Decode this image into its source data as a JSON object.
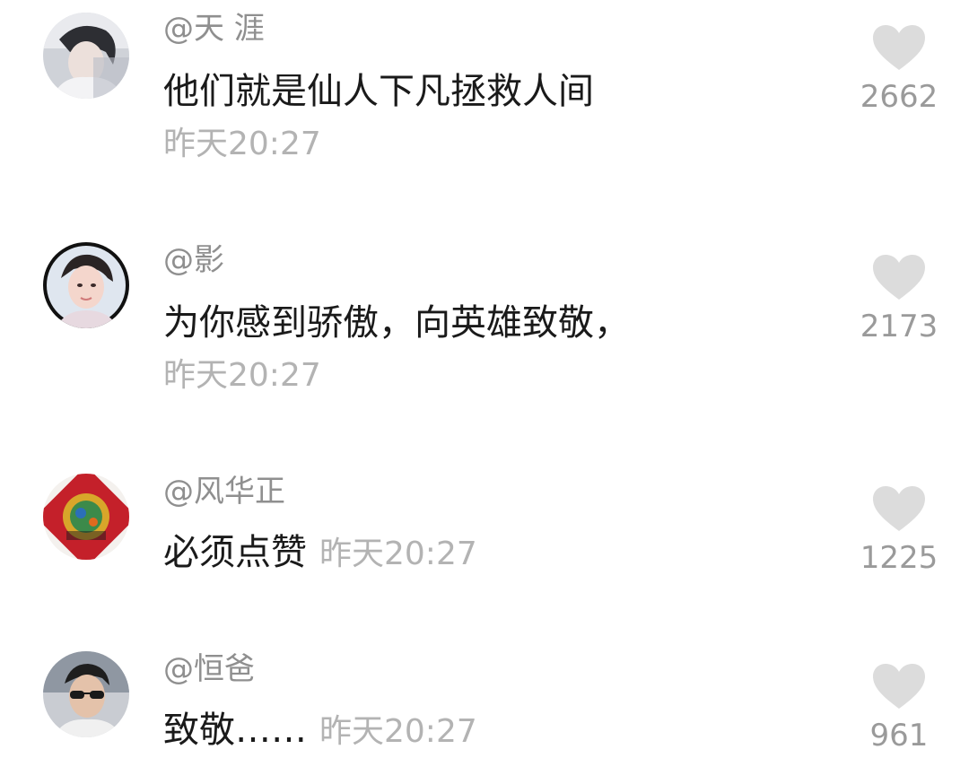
{
  "comments": [
    {
      "username": "@天  涯",
      "text": "他们就是仙人下凡拯救人间",
      "time": "昨天20:27",
      "likes": "2662"
    },
    {
      "username": "@影",
      "text": "为你感到骄傲，向英雄致敬，",
      "time": "昨天20:27",
      "likes": "2173"
    },
    {
      "username": "@风华正",
      "text": "必须点赞",
      "time": "昨天20:27",
      "likes": "1225"
    },
    {
      "username": "@恒爸",
      "text": "致敬……",
      "time": "昨天20:27",
      "likes": "961"
    }
  ],
  "colors": {
    "username": "#8f8f8f",
    "text": "#1a1a1a",
    "time": "#b3b3b3",
    "heart": "#dcdcdc",
    "count": "#9a9a9a"
  }
}
